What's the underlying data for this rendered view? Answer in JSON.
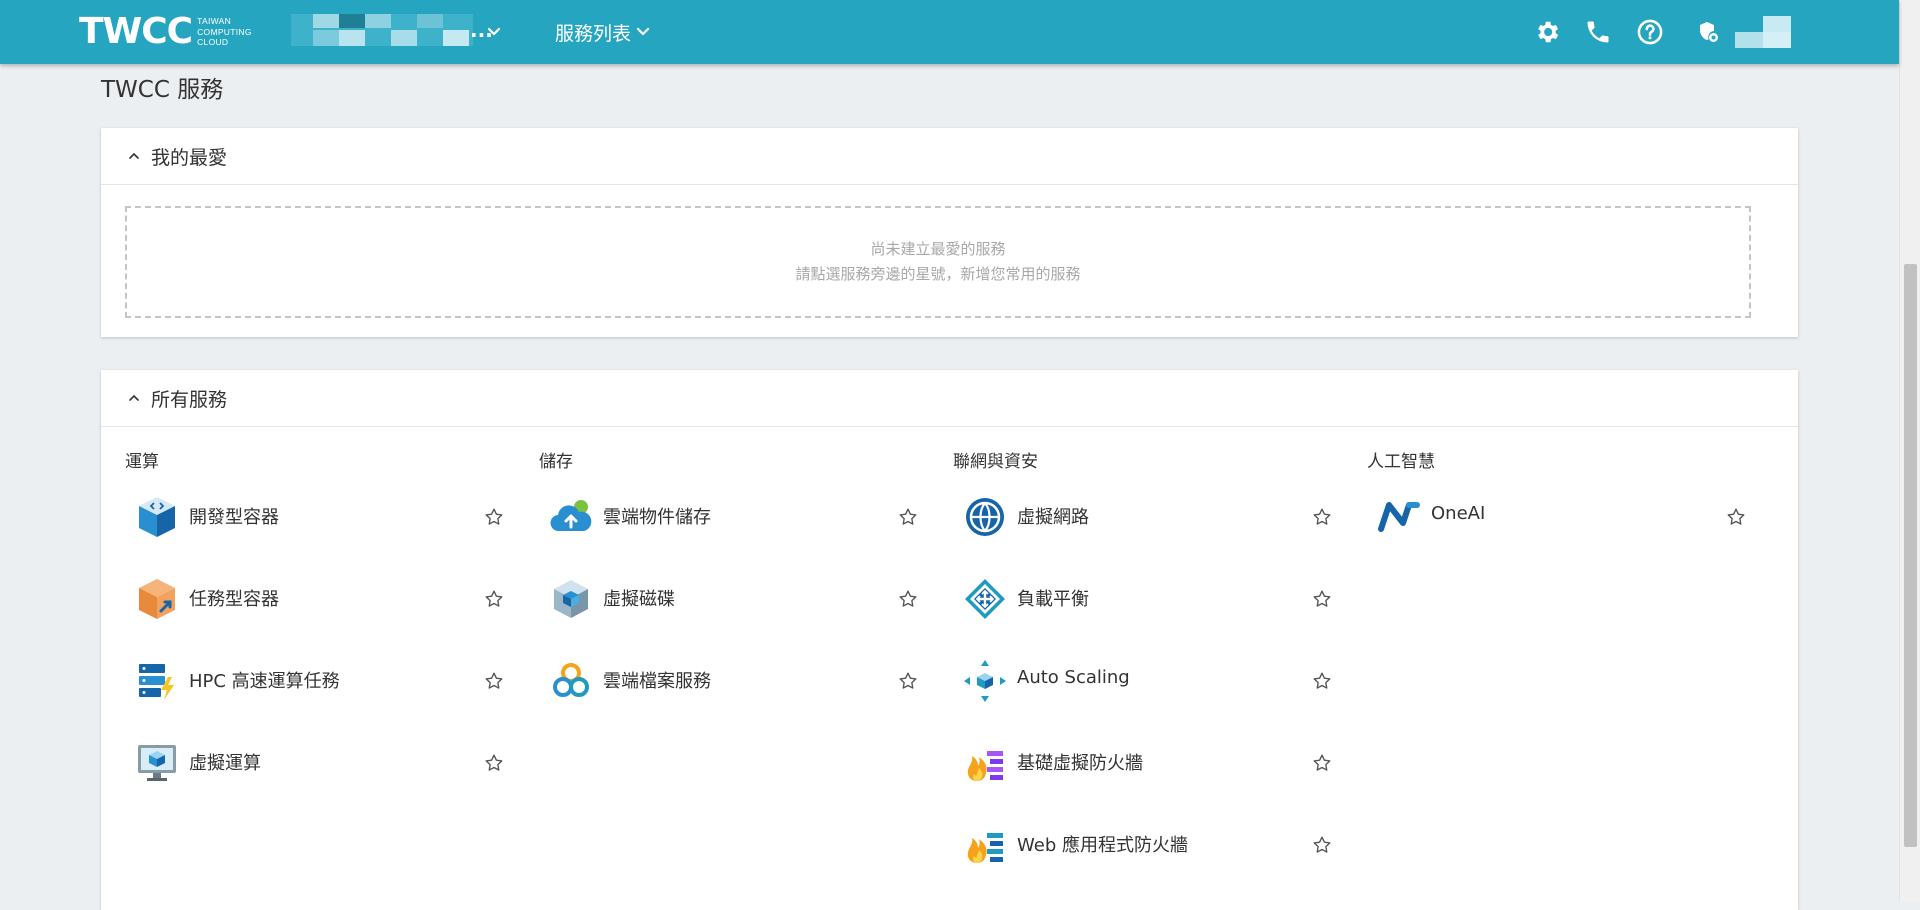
{
  "header": {
    "logo_text": "TWCC",
    "logo_sub": [
      "TAIWAN",
      "COMPUTING",
      "CLOUD"
    ],
    "project_ellipsis": "...",
    "services_menu_label": "服務列表",
    "icons": [
      "gear-icon",
      "phone-icon",
      "help-icon",
      "user-shield-icon"
    ]
  },
  "page_title": "TWCC 服務",
  "favorites": {
    "title": "我的最愛",
    "empty_line1": "尚未建立最愛的服務",
    "empty_line2": "請點選服務旁邊的星號，新增您常用的服務"
  },
  "all_services": {
    "title": "所有服務",
    "columns": [
      {
        "title": "運算",
        "items": [
          {
            "label": "開發型容器",
            "icon": "dev-container-icon"
          },
          {
            "label": "任務型容器",
            "icon": "job-container-icon"
          },
          {
            "label": "HPC 高速運算任務",
            "icon": "hpc-job-icon"
          },
          {
            "label": "虛擬運算",
            "icon": "virtual-compute-icon"
          }
        ]
      },
      {
        "title": "儲存",
        "items": [
          {
            "label": "雲端物件儲存",
            "icon": "cloud-object-storage-icon"
          },
          {
            "label": "虛擬磁碟",
            "icon": "virtual-disk-icon"
          },
          {
            "label": "雲端檔案服務",
            "icon": "cloud-file-service-icon"
          }
        ]
      },
      {
        "title": "聯網與資安",
        "items": [
          {
            "label": "虛擬網路",
            "icon": "virtual-network-icon"
          },
          {
            "label": "負載平衡",
            "icon": "load-balancer-icon"
          },
          {
            "label": "Auto Scaling",
            "icon": "auto-scaling-icon"
          },
          {
            "label": "基礎虛擬防火牆",
            "icon": "basic-firewall-icon"
          },
          {
            "label": "Web 應用程式防火牆",
            "icon": "web-app-firewall-icon"
          }
        ]
      },
      {
        "title": "人工智慧",
        "items": [
          {
            "label": "OneAI",
            "icon": "oneai-icon"
          }
        ]
      }
    ]
  },
  "colors": {
    "header": "#26a5c1",
    "background": "#eceff1",
    "card": "#ffffff",
    "text": "#333333",
    "muted_text": "#a8a8a8"
  }
}
